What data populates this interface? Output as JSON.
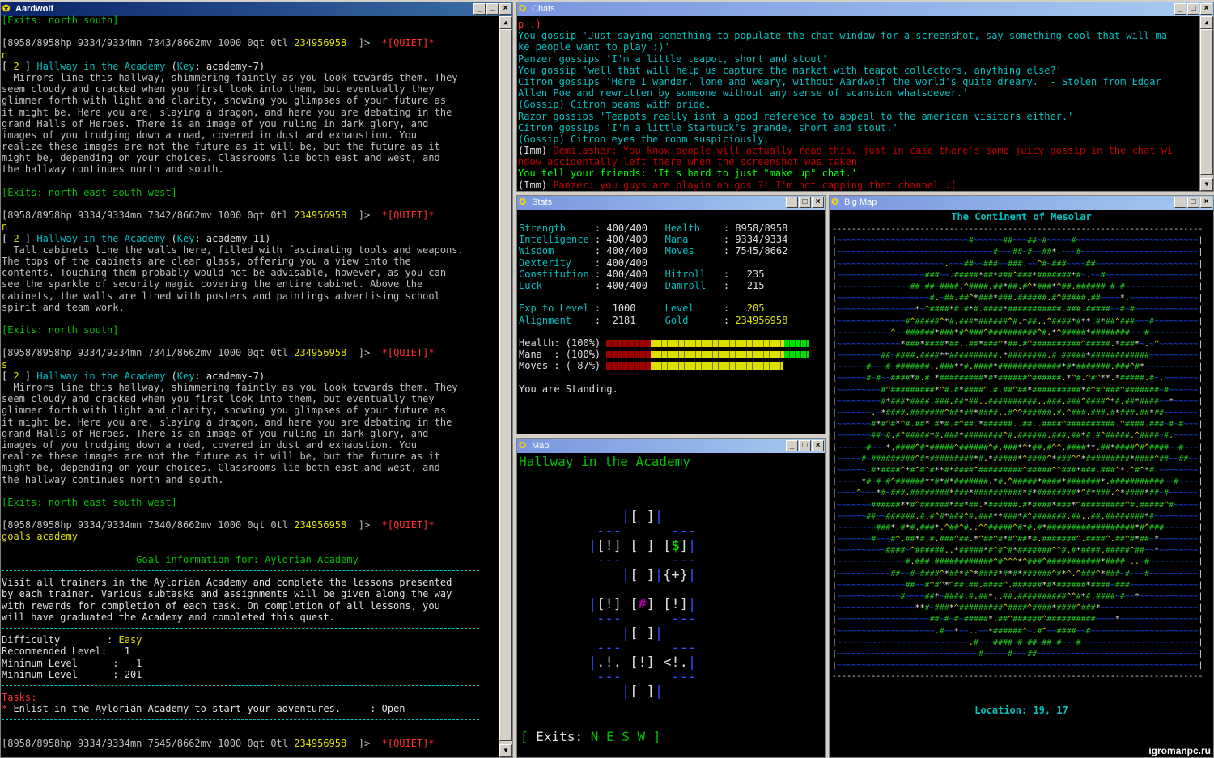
{
  "windows": {
    "main": {
      "title": "Aardwolf"
    },
    "chats": {
      "title": "Chats"
    },
    "stats": {
      "title": "Stats"
    },
    "map": {
      "title": "Map"
    },
    "bigmap": {
      "title": "Big Map"
    }
  },
  "main_lines": [
    {
      "t": "[Exits: north south]",
      "c": "g"
    },
    {
      "t": "",
      "c": ""
    },
    {
      "prompt": true,
      "room": "",
      "dir": ""
    },
    {
      "t": "n",
      "c": "y"
    },
    {
      "room": true,
      "num": "2",
      "name": "Hallway in the Academy",
      "key": "academy-7"
    },
    {
      "t": "  Mirrors line this hallway, shimmering faintly as you look towards them. They"
    },
    {
      "t": "seem cloudy and cracked when you first look into them, but eventually they"
    },
    {
      "t": "glimmer forth with light and clarity, showing you glimpses of your future as"
    },
    {
      "t": "it might be. Here you are, slaying a dragon, and here you are debating in the"
    },
    {
      "t": "grand Halls of Heroes. There is an image of you ruling in dark glory, and"
    },
    {
      "t": "images of you trudging down a road, covered in dust and exhaustion. You"
    },
    {
      "t": "realize these images are not the future as it will be, but the future as it"
    },
    {
      "t": "might be, depending on your choices. Classrooms lie both east and west, and"
    },
    {
      "t": "the hallway continues north and south."
    },
    {
      "t": "",
      "c": ""
    },
    {
      "t": "[Exits: north east south west]",
      "c": "g"
    },
    {
      "t": "",
      "c": ""
    },
    {
      "prompt": true
    },
    {
      "t": "n",
      "c": "y"
    },
    {
      "room": true,
      "num": "2",
      "name": "Hallway in the Academy",
      "key": "academy-11"
    },
    {
      "t": "  Tall cabinets line the walls here, filled with fascinating tools and weapons."
    },
    {
      "t": "The tops of the cabinets are clear glass, offering you a view into the"
    },
    {
      "t": "contents. Touching them probably would not be advisable, however, as you can"
    },
    {
      "t": "see the sparkle of security magic covering the entire cabinet. Above the"
    },
    {
      "t": "cabinets, the walls are lined with posters and paintings advertising school"
    },
    {
      "t": "spirit and team work."
    },
    {
      "t": "",
      "c": ""
    },
    {
      "t": "[Exits: north south]",
      "c": "g"
    },
    {
      "t": "",
      "c": ""
    },
    {
      "prompt": true
    },
    {
      "t": "s",
      "c": "y"
    },
    {
      "room": true,
      "num": "2",
      "name": "Hallway in the Academy",
      "key": "academy-7"
    },
    {
      "t": "  Mirrors line this hallway, shimmering faintly as you look towards them. They"
    },
    {
      "t": "seem cloudy and cracked when you first look into them, but eventually they"
    },
    {
      "t": "glimmer forth with light and clarity, showing you glimpses of your future as"
    },
    {
      "t": "it might be. Here you are, slaying a dragon, and here you are debating in the"
    },
    {
      "t": "grand Halls of Heroes. There is an image of you ruling in dark glory, and"
    },
    {
      "t": "images of you trudging down a road, covered in dust and exhaustion. You"
    },
    {
      "t": "realize these images are not the future as it will be, but the future as it"
    },
    {
      "t": "might be, depending on your choices. Classrooms lie both east and west, and"
    },
    {
      "t": "the hallway continues north and south."
    },
    {
      "t": "",
      "c": ""
    },
    {
      "t": "[Exits: north east south west]",
      "c": "g"
    },
    {
      "t": "",
      "c": ""
    },
    {
      "prompt": true
    },
    {
      "t": "goals academy",
      "c": "y"
    },
    {
      "t": "",
      "c": ""
    },
    {
      "t": "                       Goal information for: Aylorian Academy",
      "c": "g"
    },
    {
      "sep": true
    },
    {
      "t": "Visit all trainers in the Aylorian Academy and complete the lessons presented",
      "c": "w"
    },
    {
      "t": "by each trainer. Various subtasks and assignments will be given along the way",
      "c": "w"
    },
    {
      "t": "with rewards for completion of each task. On completion of all lessons, you",
      "c": "w"
    },
    {
      "t": "will have graduated the Academy and completed this quest.",
      "c": "w"
    },
    {
      "sep": true
    },
    {
      "kv": true,
      "k": "Difficulty        : ",
      "v": "Easy",
      "vc": "y"
    },
    {
      "kv": true,
      "k": "Recommended Level:   ",
      "v": "1",
      "vc": "w"
    },
    {
      "kv": true,
      "k": "Minimum Level      :   ",
      "v": "1",
      "vc": "w"
    },
    {
      "kv": true,
      "k": "Minimum Level      : ",
      "v": "201",
      "vc": "w"
    },
    {
      "sep": true
    },
    {
      "t": "Tasks:",
      "c": "r"
    },
    {
      "task": true,
      "t": " Enlist in the Aylorian Academy to start your adventures.     : Open"
    },
    {
      "sep": true
    },
    {
      "t": "",
      "c": ""
    },
    {
      "prompt": true,
      "mv": "7545"
    }
  ],
  "prompt": {
    "hp": "8958/8958hp",
    "mn": "9334/9334mn",
    "mv_prefix": "/8662mv",
    "mv_values": [
      "7343",
      "7342",
      "7341",
      "7340"
    ],
    "qt": "1000 0qt 0tl",
    "gold": "234956958",
    "tail": "]>",
    "quiet": "*[QUIET]*"
  },
  "chat_lines": [
    {
      "t": "p :)",
      "c": "r"
    },
    {
      "t": "You gossip 'Just saying something to populate the chat window for a screenshot, say something cool that will ma",
      "c": "c"
    },
    {
      "t": "ke people want to play :)'",
      "c": "c"
    },
    {
      "t": "Panzer gossips 'I'm a little teapot, short and stout'",
      "c": "c"
    },
    {
      "t": "You gossip 'well that will help us capture the market with teapot collectors, anything else?'",
      "c": "c"
    },
    {
      "t": "Citron gossips 'Here I wander, lone and weary, without Aardwolf the world's quite dreary.  - Stolen from Edgar",
      "c": "c"
    },
    {
      "t": "Allen Poe and rewritten by someone without any sense of scansion whatsoever.'",
      "c": "c"
    },
    {
      "t": "(Gossip) Citron beams with pride.",
      "c": "c"
    },
    {
      "t": "Razor gossips 'Teapots really isnt a good reference to appeal to the american visitors either.'",
      "c": "c"
    },
    {
      "t": "Citron gossips 'I'm a little Starbuck's grande, short and stout.'",
      "c": "c"
    },
    {
      "t": "(Gossip) Citron eyes the room suspiciously.",
      "c": "c"
    },
    {
      "imm": true,
      "t": "Demilasher: You know people will actually read this, just in case there's some juicy gossip in the chat wi"
    },
    {
      "t": "ndow accidentally left there when the screenshot was taken.",
      "c": "rb"
    },
    {
      "t": "You tell your friends: 'It's hard to just \"make up\" chat.'",
      "c": "gb"
    },
    {
      "imm": true,
      "t": "Panzer: you guys are playin on gos ?! I'm not capping that channel :("
    }
  ],
  "imm_tag": "(Imm)",
  "stats": {
    "rows": [
      {
        "k": "Strength",
        "v": "400/400",
        "k2": "Health",
        "v2": "8958/8958"
      },
      {
        "k": "Intelligence",
        "v": "400/400",
        "k2": "Mana",
        "v2": "9334/9334"
      },
      {
        "k": "Wisdom",
        "v": "400/400",
        "k2": "Moves",
        "v2": "7545/8662"
      },
      {
        "k": "Dexterity",
        "v": "400/400",
        "k2": "",
        "v2": ""
      },
      {
        "k": "Constitution",
        "v": "400/400",
        "k2": "Hitroll",
        "v2": "  235"
      },
      {
        "k": "Luck",
        "v": "400/400",
        "k2": "Damroll",
        "v2": "  215"
      }
    ],
    "exp_label": "Exp to Level",
    "exp": "1000",
    "level_label": "Level",
    "level": "205",
    "align_label": "Alignment",
    "align": "2181",
    "gold_label": "Gold",
    "gold": "234956958",
    "bars": [
      {
        "k": "Health",
        "pct": "(100%)",
        "fill": 1.0
      },
      {
        "k": "Mana  ",
        "pct": "(100%)",
        "fill": 1.0
      },
      {
        "k": "Moves ",
        "pct": "( 87%)",
        "fill": 0.87
      }
    ],
    "status": "You are Standing."
  },
  "map": {
    "room": "Hallway in the Academy",
    "exits_label": "Exits:",
    "exits": "N E S W",
    "bracket_open": "[",
    "bracket_close": "]",
    "cells": {
      "empty": "[ ]",
      "exc": "[!]",
      "shop": "[$]",
      "plus": "{+}",
      "here": "[#]",
      "dot": ".!.",
      "lt": "<!."
    }
  },
  "bigmap": {
    "title": "The Continent of Mesolar",
    "location": "Location: 19, 17"
  },
  "watermark": "igromanpc.ru",
  "colors": {
    "titlebar_active": "#0a246a",
    "titlebar_inactive": "#7a96df",
    "prompt_gold": "#e0e000",
    "exits": "#00c000"
  }
}
